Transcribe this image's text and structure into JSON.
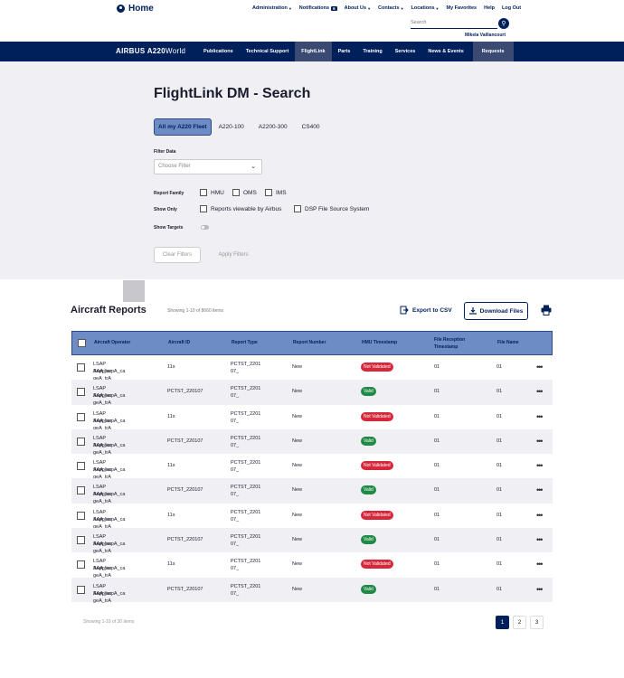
{
  "header": {
    "home_label": "Home",
    "top_nav": [
      {
        "label": "Administration",
        "caret": true
      },
      {
        "label": "Notifications",
        "count": "6"
      },
      {
        "label": "About Us",
        "caret": true
      },
      {
        "label": "Contacts",
        "caret": true
      },
      {
        "label": "Locations",
        "caret": true
      },
      {
        "label": "My Favorites"
      },
      {
        "label": "Help"
      },
      {
        "label": "Log Out"
      }
    ],
    "search_placeholder": "Search",
    "user_name": "Mikela Vaillancourt"
  },
  "main_nav": {
    "brand": "AIRBUS A220",
    "brand_suffix": "World",
    "items": [
      "Publications",
      "Technical Support",
      "FlightLink",
      "Parts",
      "Training",
      "Services",
      "News & Events",
      "Requests"
    ]
  },
  "page_title": "FlightLink DM - Search",
  "fleet_tabs": [
    "All my A220 Fleet",
    "A220-100",
    "A2200-300",
    "CS400"
  ],
  "filters": {
    "filter_data_label": "Filter Data",
    "filter_data_placeholder": "Choose Filter",
    "report_family_label": "Report Family",
    "report_family_options": [
      "HMU",
      "OMS",
      "IMS"
    ],
    "show_only_label": "Show Only",
    "show_only_options": [
      "Reports viewable by Airbus",
      "DSP File Source System"
    ],
    "show_targets_label": "Show Targets",
    "clear_label": "Clear Filters",
    "apply_label": "Apply Filters"
  },
  "reports": {
    "title": "Aircraft Reports",
    "showing_top": "Showing 1-10 of 8660 items",
    "export_label": "Export to CSV",
    "download_label": "Download Files",
    "columns": [
      "Aircraft Operator",
      "Aircraft ID",
      "Report Type",
      "Report Number",
      "HMU Timestamp",
      "File Reception Timestamp",
      "File Name"
    ],
    "rows": [
      {
        "operator1": "LSAP Supplier",
        "operator2": "AAA_sapA_ca geA_trA",
        "aircraft_id": "11s",
        "report_type1": "PCTST_2201",
        "report_type2": "07_",
        "report_number": "New",
        "hmu_status": "Not Validated",
        "reception": "01",
        "file_name": "01"
      },
      {
        "operator1": "LSAP Supplier",
        "operator2": "AAA_sapA_ca geA_trA",
        "aircraft_id": "PCTST_220107",
        "report_type1": "PCTST_2201",
        "report_type2": "07_",
        "report_number": "New",
        "hmu_status": "Valid",
        "reception": "01",
        "file_name": "01"
      },
      {
        "operator1": "LSAP Supplier",
        "operator2": "AAA_sapA_ca geA_trA",
        "aircraft_id": "11s",
        "report_type1": "PCTST_2201",
        "report_type2": "07_",
        "report_number": "New",
        "hmu_status": "Not Validated",
        "reception": "01",
        "file_name": "01"
      },
      {
        "operator1": "LSAP Supplier",
        "operator2": "AAA_sapA_ca geA_trA",
        "aircraft_id": "PCTST_220107",
        "report_type1": "PCTST_2201",
        "report_type2": "07_",
        "report_number": "New",
        "hmu_status": "Valid",
        "reception": "01",
        "file_name": "01"
      },
      {
        "operator1": "LSAP Supplier",
        "operator2": "AAA_sapA_ca geA_trA",
        "aircraft_id": "11s",
        "report_type1": "PCTST_2201",
        "report_type2": "07_",
        "report_number": "New",
        "hmu_status": "Not Validated",
        "reception": "01",
        "file_name": "01"
      },
      {
        "operator1": "LSAP Supplier",
        "operator2": "AAA_sapA_ca geA_trA",
        "aircraft_id": "PCTST_220107",
        "report_type1": "PCTST_2201",
        "report_type2": "07_",
        "report_number": "New",
        "hmu_status": "Valid",
        "reception": "01",
        "file_name": "01"
      },
      {
        "operator1": "LSAP Supplier",
        "operator2": "AAA_sapA_ca geA_trA",
        "aircraft_id": "11s",
        "report_type1": "PCTST_2201",
        "report_type2": "07_",
        "report_number": "New",
        "hmu_status": "Not Validated",
        "reception": "01",
        "file_name": "01"
      },
      {
        "operator1": "LSAP Supplier",
        "operator2": "AAA_sapA_ca geA_trA",
        "aircraft_id": "PCTST_220107",
        "report_type1": "PCTST_2201",
        "report_type2": "07_",
        "report_number": "New",
        "hmu_status": "Valid",
        "reception": "01",
        "file_name": "01"
      },
      {
        "operator1": "LSAP Supplier",
        "operator2": "AAA_sapA_ca geA_trA",
        "aircraft_id": "11s",
        "report_type1": "PCTST_2201",
        "report_type2": "07_",
        "report_number": "New",
        "hmu_status": "Not Validated",
        "reception": "01",
        "file_name": "01"
      },
      {
        "operator1": "LSAP Supplier",
        "operator2": "AAA_sapA_ca geA_trA",
        "aircraft_id": "PCTST_220107",
        "report_type1": "PCTST_2201",
        "report_type2": "07_",
        "report_number": "New",
        "hmu_status": "Valid",
        "reception": "01",
        "file_name": "01"
      }
    ],
    "showing_bottom": "Showing 1-10 of 30 items",
    "pages": [
      "1",
      "2",
      "3"
    ]
  },
  "colors": {
    "brand": "#00205b",
    "header_row": "#6d8cc6",
    "status_invalid": "#d6283a",
    "status_valid": "#1f8a46"
  }
}
